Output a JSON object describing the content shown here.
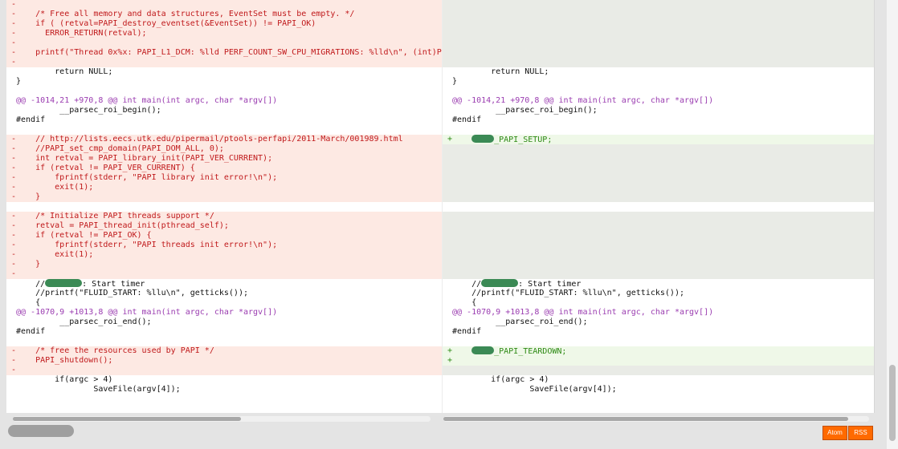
{
  "colors": {
    "deleted_bg": "#fde9e3",
    "deleted_text": "#c0191b",
    "added_bg": "#eff8e8",
    "added_text": "#2d8a14",
    "empty_bg": "#e9ebe6",
    "hunk_text": "#9a3cb0",
    "feed_button": "#ff6a00"
  },
  "left_lines": [
    {
      "kind": "del",
      "marker": "-",
      "text": ""
    },
    {
      "kind": "del",
      "marker": "-",
      "text": "    /* Free all memory and data structures, EventSet must be empty. */"
    },
    {
      "kind": "del",
      "marker": "-",
      "text": "    if ( (retval=PAPI_destroy_eventset(&EventSet)) != PAPI_OK)"
    },
    {
      "kind": "del",
      "marker": "-",
      "text": "      ERROR_RETURN(retval);"
    },
    {
      "kind": "del",
      "marker": "-",
      "text": ""
    },
    {
      "kind": "del",
      "marker": "-",
      "text": "    printf(\"Thread 0x%x: PAPI_L1_DCM: %lld PERF_COUNT_SW_CPU_MIGRATIONS: %lld\\n\", (int)P"
    },
    {
      "kind": "del",
      "marker": "-",
      "text": ""
    },
    {
      "kind": "ctx",
      "marker": "",
      "text": "        return NULL;"
    },
    {
      "kind": "ctx",
      "marker": "",
      "text": "}"
    },
    {
      "kind": "blank",
      "marker": "",
      "text": ""
    },
    {
      "kind": "hunk",
      "marker": "",
      "text": "@@ -1014,21 +970,8 @@ int main(int argc, char *argv[])"
    },
    {
      "kind": "ctx",
      "marker": "",
      "text": "         __parsec_roi_begin();"
    },
    {
      "kind": "ctx",
      "marker": "",
      "text": "#endif"
    },
    {
      "kind": "blank",
      "marker": "",
      "text": ""
    },
    {
      "kind": "del",
      "marker": "-",
      "text": "    // http://lists.eecs.utk.edu/pipermail/ptools-perfapi/2011-March/001989.html"
    },
    {
      "kind": "del",
      "marker": "-",
      "text": "    //PAPI_set_cmp_domain(PAPI_DOM_ALL, 0);"
    },
    {
      "kind": "del",
      "marker": "-",
      "text": "    int retval = PAPI_library_init(PAPI_VER_CURRENT);"
    },
    {
      "kind": "del",
      "marker": "-",
      "text": "    if (retval != PAPI_VER_CURRENT) {"
    },
    {
      "kind": "del",
      "marker": "-",
      "text": "        fprintf(stderr, \"PAPI library init error!\\n\");"
    },
    {
      "kind": "del",
      "marker": "-",
      "text": "        exit(1);"
    },
    {
      "kind": "del",
      "marker": "-",
      "text": "    }"
    },
    {
      "kind": "blank",
      "marker": "",
      "text": ""
    },
    {
      "kind": "del",
      "marker": "-",
      "text": "    /* Initialize PAPI threads support */"
    },
    {
      "kind": "del",
      "marker": "-",
      "text": "    retval = PAPI_thread_init(pthread_self);"
    },
    {
      "kind": "del",
      "marker": "-",
      "text": "    if (retval != PAPI_OK) {"
    },
    {
      "kind": "del",
      "marker": "-",
      "text": "        fprintf(stderr, \"PAPI threads init error!\\n\");"
    },
    {
      "kind": "del",
      "marker": "-",
      "text": "        exit(1);"
    },
    {
      "kind": "del",
      "marker": "-",
      "text": "    }"
    },
    {
      "kind": "del",
      "marker": "-",
      "text": ""
    },
    {
      "kind": "ctx",
      "marker": "",
      "text": "    //",
      "blur": "w2",
      "after": ": Start timer"
    },
    {
      "kind": "ctx",
      "marker": "",
      "text": "    //printf(\"FLUID_START: %llu\\n\", getticks());"
    },
    {
      "kind": "ctx",
      "marker": "",
      "text": "    {"
    },
    {
      "kind": "hunk",
      "marker": "",
      "text": "@@ -1070,9 +1013,8 @@ int main(int argc, char *argv[])"
    },
    {
      "kind": "ctx",
      "marker": "",
      "text": "         __parsec_roi_end();"
    },
    {
      "kind": "ctx",
      "marker": "",
      "text": "#endif"
    },
    {
      "kind": "blank",
      "marker": "",
      "text": ""
    },
    {
      "kind": "del",
      "marker": "-",
      "text": "    /* free the resources used by PAPI */"
    },
    {
      "kind": "del",
      "marker": "-",
      "text": "    PAPI_shutdown();"
    },
    {
      "kind": "del",
      "marker": "-",
      "text": ""
    },
    {
      "kind": "ctx",
      "marker": "",
      "text": "        if(argc > 4)"
    },
    {
      "kind": "ctx",
      "marker": "",
      "text": "                SaveFile(argv[4]);"
    }
  ],
  "right_lines": [
    {
      "kind": "empty",
      "marker": "",
      "text": ""
    },
    {
      "kind": "empty",
      "marker": "",
      "text": ""
    },
    {
      "kind": "empty",
      "marker": "",
      "text": ""
    },
    {
      "kind": "empty",
      "marker": "",
      "text": ""
    },
    {
      "kind": "empty",
      "marker": "",
      "text": ""
    },
    {
      "kind": "empty",
      "marker": "",
      "text": ""
    },
    {
      "kind": "empty",
      "marker": "",
      "text": ""
    },
    {
      "kind": "ctx",
      "marker": "",
      "text": "        return NULL;"
    },
    {
      "kind": "ctx",
      "marker": "",
      "text": "}"
    },
    {
      "kind": "blank",
      "marker": "",
      "text": ""
    },
    {
      "kind": "hunk",
      "marker": "",
      "text": "@@ -1014,21 +970,8 @@ int main(int argc, char *argv[])"
    },
    {
      "kind": "ctx",
      "marker": "",
      "text": "         __parsec_roi_begin();"
    },
    {
      "kind": "ctx",
      "marker": "",
      "text": "#endif"
    },
    {
      "kind": "blank",
      "marker": "",
      "text": ""
    },
    {
      "kind": "add",
      "marker": "+",
      "text": "    ",
      "blur": "w1",
      "after": "_PAPI_SETUP;"
    },
    {
      "kind": "empty",
      "marker": "",
      "text": ""
    },
    {
      "kind": "empty",
      "marker": "",
      "text": ""
    },
    {
      "kind": "empty",
      "marker": "",
      "text": ""
    },
    {
      "kind": "empty",
      "marker": "",
      "text": ""
    },
    {
      "kind": "empty",
      "marker": "",
      "text": ""
    },
    {
      "kind": "empty",
      "marker": "",
      "text": ""
    },
    {
      "kind": "blank",
      "marker": "",
      "text": ""
    },
    {
      "kind": "empty",
      "marker": "",
      "text": ""
    },
    {
      "kind": "empty",
      "marker": "",
      "text": ""
    },
    {
      "kind": "empty",
      "marker": "",
      "text": ""
    },
    {
      "kind": "empty",
      "marker": "",
      "text": ""
    },
    {
      "kind": "empty",
      "marker": "",
      "text": ""
    },
    {
      "kind": "empty",
      "marker": "",
      "text": ""
    },
    {
      "kind": "empty",
      "marker": "",
      "text": ""
    },
    {
      "kind": "ctx",
      "marker": "",
      "text": "    //",
      "blur": "w2",
      "after": ": Start timer"
    },
    {
      "kind": "ctx",
      "marker": "",
      "text": "    //printf(\"FLUID_START: %llu\\n\", getticks());"
    },
    {
      "kind": "ctx",
      "marker": "",
      "text": "    {"
    },
    {
      "kind": "hunk",
      "marker": "",
      "text": "@@ -1070,9 +1013,8 @@ int main(int argc, char *argv[])"
    },
    {
      "kind": "ctx",
      "marker": "",
      "text": "         __parsec_roi_end();"
    },
    {
      "kind": "ctx",
      "marker": "",
      "text": "#endif"
    },
    {
      "kind": "blank",
      "marker": "",
      "text": ""
    },
    {
      "kind": "add",
      "marker": "+",
      "text": "    ",
      "blur": "w1",
      "after": "_PAPI_TEARDOWN;"
    },
    {
      "kind": "add",
      "marker": "+",
      "text": ""
    },
    {
      "kind": "empty",
      "marker": "",
      "text": ""
    },
    {
      "kind": "ctx",
      "marker": "",
      "text": "        if(argc > 4)"
    },
    {
      "kind": "ctx",
      "marker": "",
      "text": "                SaveFile(argv[4]);"
    }
  ],
  "footer": {
    "atom_label": "Atom",
    "rss_label": "RSS"
  }
}
